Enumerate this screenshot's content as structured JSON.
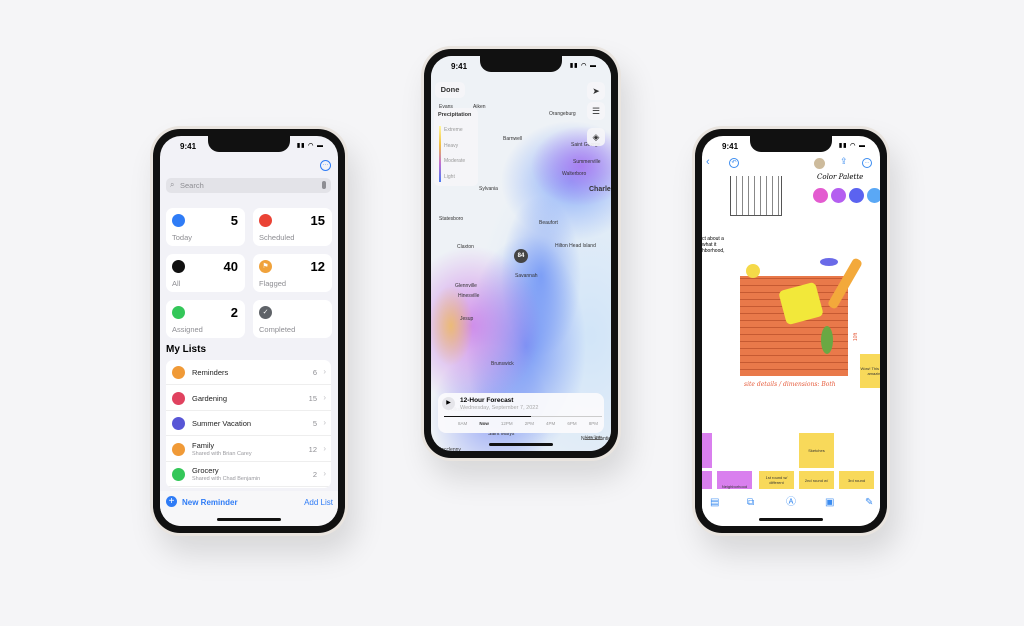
{
  "reminders": {
    "time": "9:41",
    "search_placeholder": "Search",
    "cards": [
      {
        "label": "Today",
        "count": "5",
        "color": "#2f7cf6",
        "icon": "calendar-icon"
      },
      {
        "label": "Scheduled",
        "count": "15",
        "color": "#ea4335",
        "icon": "calendar-grid-icon"
      },
      {
        "label": "All",
        "count": "40",
        "color": "#111111",
        "icon": "tray-icon"
      },
      {
        "label": "Flagged",
        "count": "12",
        "color": "#f0a23b",
        "icon": "flag-icon"
      },
      {
        "label": "Assigned",
        "count": "2",
        "color": "#34c759",
        "icon": "person-icon"
      },
      {
        "label": "Completed",
        "count": "",
        "color": "#5f6368",
        "icon": "checkmark-icon"
      }
    ],
    "my_lists_title": "My Lists",
    "lists": [
      {
        "name": "Reminders",
        "sub": "",
        "count": "6",
        "color": "#f09a37",
        "icon": "list-icon"
      },
      {
        "name": "Gardening",
        "sub": "",
        "count": "15",
        "color": "#e0425f",
        "icon": "leaf-icon"
      },
      {
        "name": "Summer Vacation",
        "sub": "",
        "count": "5",
        "color": "#5856d6",
        "icon": "palm-tree-icon"
      },
      {
        "name": "Family",
        "sub": "Shared with Brian Carey",
        "count": "12",
        "color": "#f09a37",
        "icon": "people-icon"
      },
      {
        "name": "Grocery",
        "sub": "Shared with Chad Benjamin",
        "count": "2",
        "color": "#34c759",
        "icon": "basket-icon"
      }
    ],
    "new_reminder": "New Reminder",
    "add_list": "Add List",
    "accent": "#2f7cf6"
  },
  "weather": {
    "time": "9:41",
    "done": "Done",
    "legend_title": "Precipitation",
    "legend": [
      "Extreme",
      "Heavy",
      "Moderate",
      "Light"
    ],
    "cities": [
      "Evans",
      "Aiken",
      "Orangeburg",
      "Barnwell",
      "Saint George",
      "Summerville",
      "Walterboro",
      "Sylvania",
      "Charleston",
      "Statesboro",
      "Beaufort",
      "Claxton",
      "Hilton Head Island",
      "Savannah",
      "Glennville",
      "Hinesville",
      "Jesup",
      "Brunswick",
      "Folkston",
      "Saint Marys",
      "Macclenny",
      "North Atlantic"
    ],
    "temp": "84",
    "forecast_title": "12-Hour Forecast",
    "forecast_date": "Wednesday, September 7, 2022",
    "timeline": [
      "8AM",
      "Now",
      "12PM",
      "2PM",
      "4PM",
      "6PM",
      "8PM"
    ],
    "progress": 0.55,
    "map_data": "Map Data"
  },
  "freeform": {
    "time": "9:41",
    "palette_label": "Color Palette",
    "palette": [
      "#e35bd0",
      "#b45ff0",
      "#5b63f0",
      "#5aa8f5"
    ],
    "caption": "site details / dimensions: Both",
    "side_text": "ct about a what it hborhood,",
    "dimension": "10ft",
    "stickies": [
      "Wow! This looks amazing",
      "Sketches",
      "Neighborhood",
      "1st round w/ different",
      "2nd round w/",
      "3rd round"
    ]
  }
}
